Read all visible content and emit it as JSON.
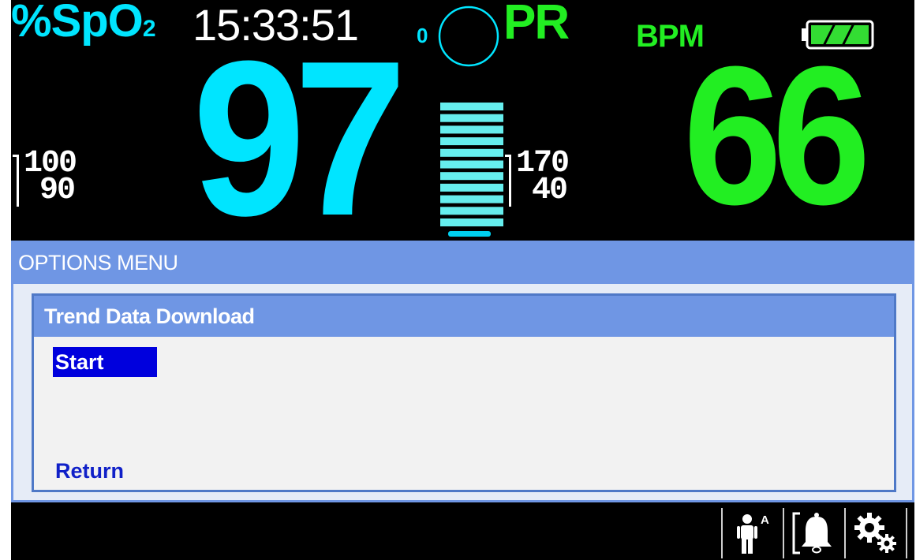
{
  "header": {
    "spo2_label": "%SpO",
    "spo2_sub": "2",
    "time": "15:33:51",
    "pleth_zero": "0",
    "pr_label": "PR",
    "bpm_label": "BPM"
  },
  "battery": {
    "level_fraction": 1.0,
    "color": "#33dd33",
    "icon": "battery-icon"
  },
  "spo2": {
    "value": "97",
    "limit_high": "100",
    "limit_low": "90",
    "color": "#00e5ff"
  },
  "pulse": {
    "value": "66",
    "limit_high": "170",
    "limit_low": "40",
    "color": "#22ee22"
  },
  "pleth_bar": {
    "segments": 11,
    "color": "#66eeee"
  },
  "options_menu": {
    "title": "OPTIONS MENU",
    "submenu": {
      "title": "Trend Data Download",
      "items": [
        {
          "label": "Start",
          "selected": true
        },
        {
          "label": "Return",
          "selected": false
        }
      ]
    }
  },
  "status_bar": {
    "icons": [
      "patient-mode-adult-icon",
      "alarm-bell-icon",
      "settings-gears-icon"
    ],
    "patient_mode_letter": "A"
  }
}
